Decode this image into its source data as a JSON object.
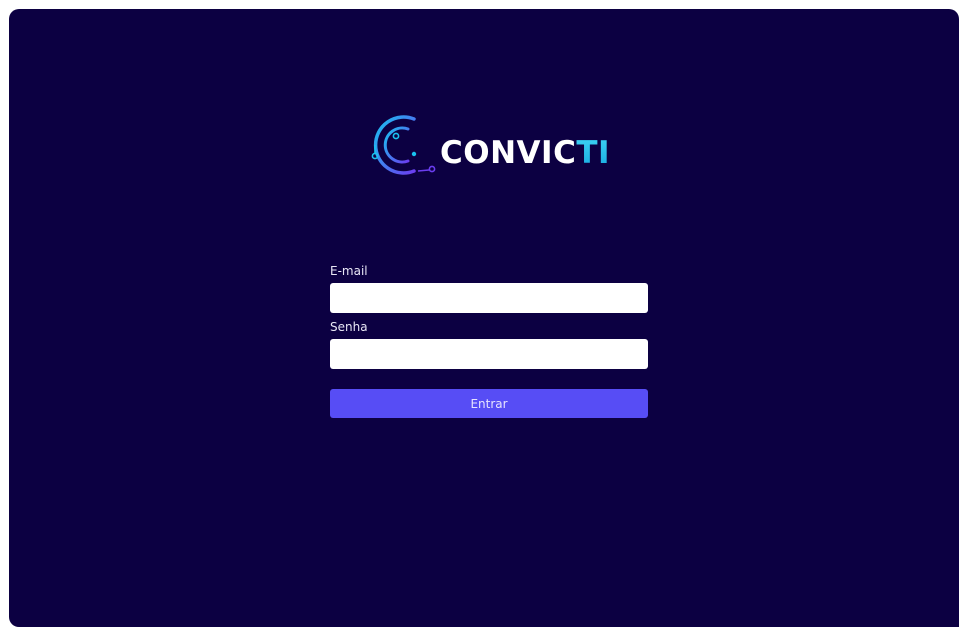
{
  "brand": {
    "name_main": "CONVIC",
    "name_accent": "TI",
    "logo_icon": "circuit-c-logo-icon",
    "colors": {
      "background": "#0c0042",
      "accent_cyan": "#19c2f0",
      "accent_purple": "#574df5",
      "text_white": "#ffffff"
    }
  },
  "login": {
    "email_label": "E-mail",
    "email_value": "",
    "password_label": "Senha",
    "password_value": "",
    "submit_label": "Entrar"
  }
}
